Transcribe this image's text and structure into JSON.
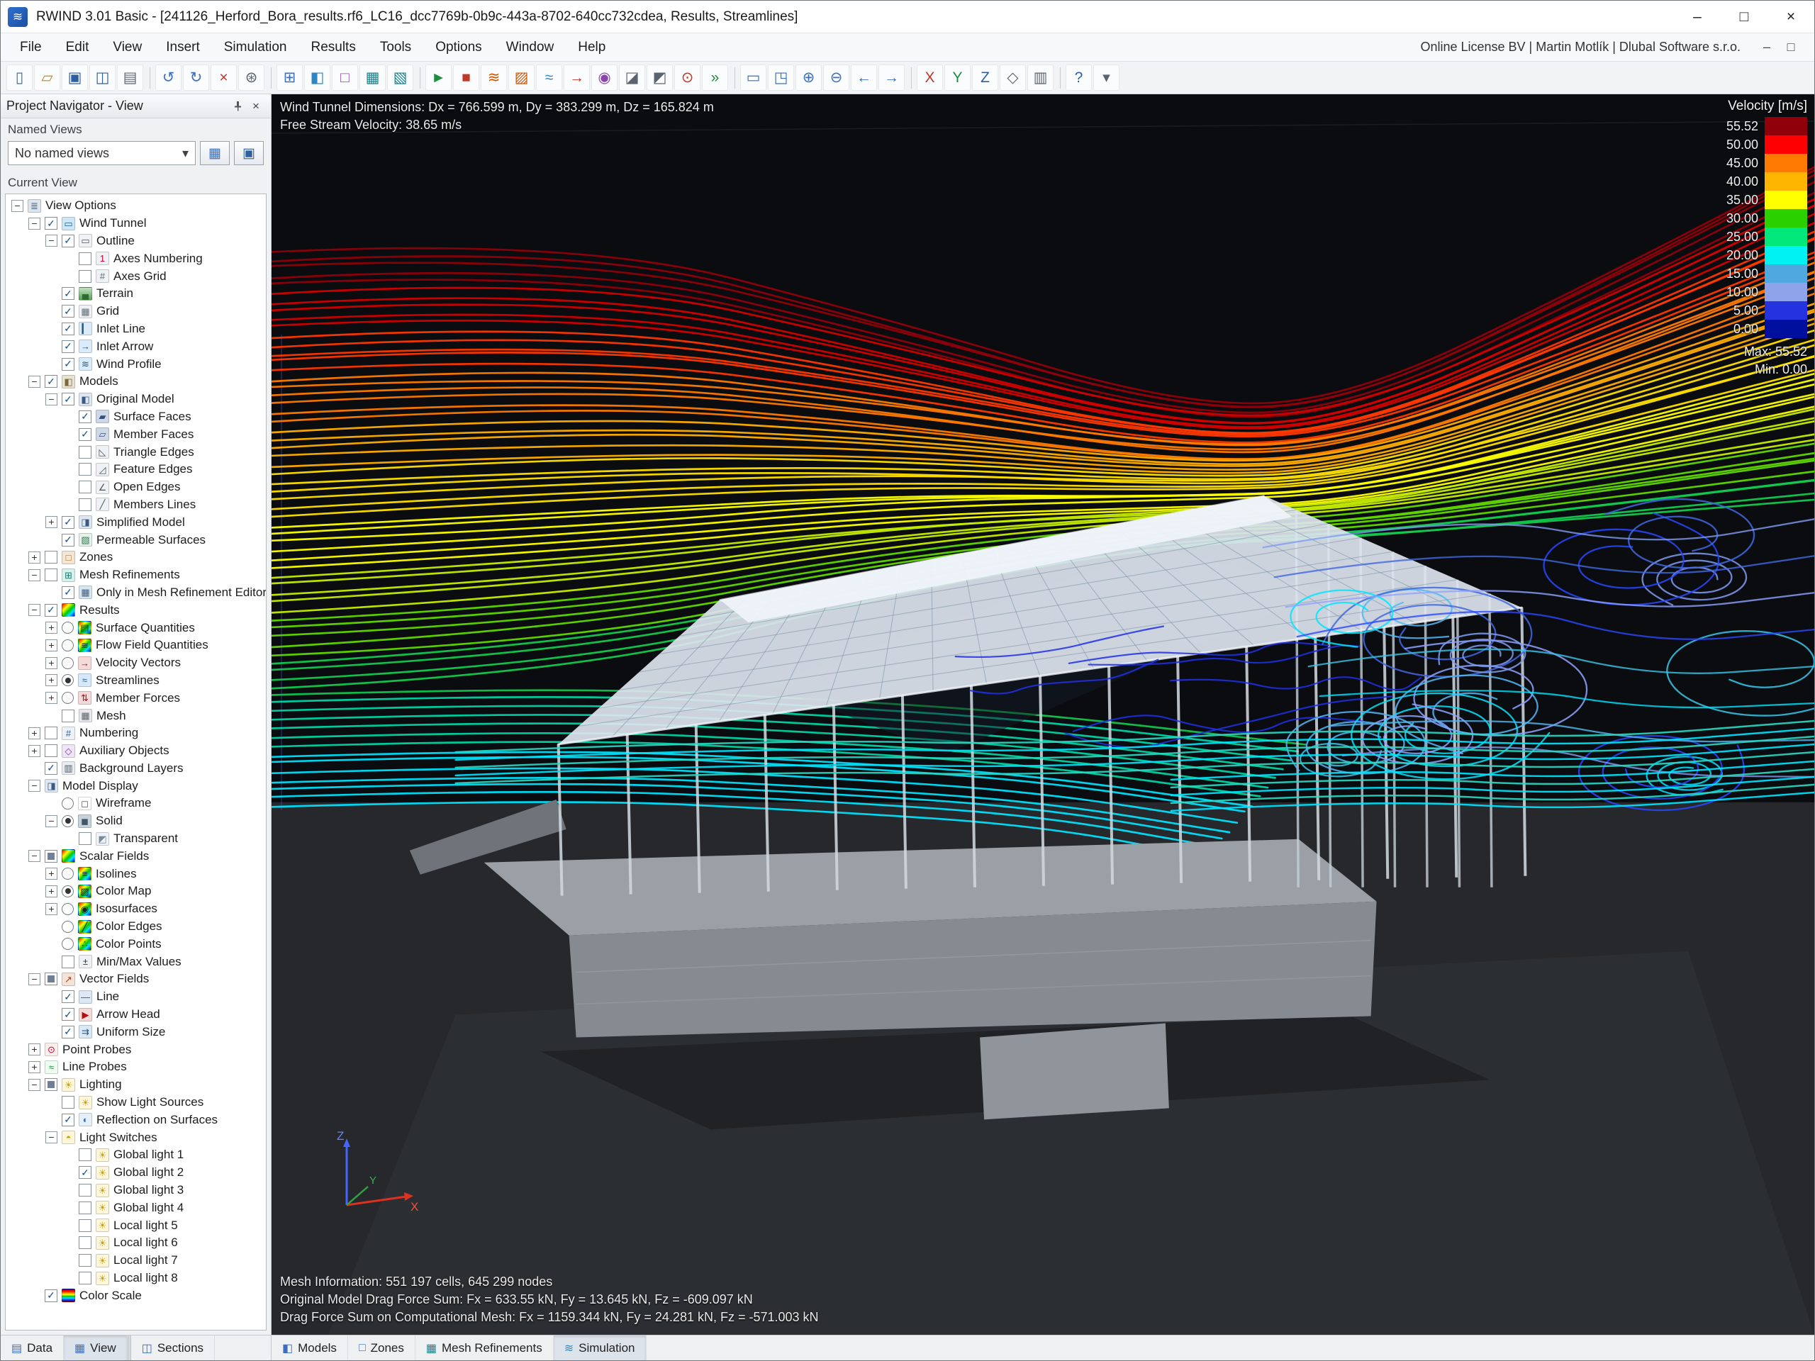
{
  "window": {
    "title": "RWIND 3.01 Basic - [241126_Herford_Bora_results.rf6_LC16_dcc7769b-0b9c-443a-8702-640cc732cdea, Results, Streamlines]",
    "buttons": [
      {
        "name": "minimize-button",
        "glyph": "–"
      },
      {
        "name": "maximize-button",
        "glyph": "□"
      },
      {
        "name": "close-button",
        "glyph": "×"
      }
    ]
  },
  "menu": {
    "items": [
      "File",
      "Edit",
      "View",
      "Insert",
      "Simulation",
      "Results",
      "Tools",
      "Options",
      "Window",
      "Help"
    ],
    "right_text": "Online License BV | Martin Motlík | Dlubal Software s.r.o.",
    "mdi_buttons": [
      {
        "name": "mdi-minimize-button",
        "glyph": "–"
      },
      {
        "name": "mdi-restore-button",
        "glyph": "□"
      }
    ]
  },
  "toolbar": {
    "items": [
      {
        "name": "new",
        "glyph": "▯",
        "color": "#4f6b8f"
      },
      {
        "name": "open",
        "glyph": "▱",
        "color": "#c08a1a"
      },
      {
        "name": "save",
        "glyph": "▣",
        "color": "#2f5fa3"
      },
      {
        "name": "save-all",
        "glyph": "◫",
        "color": "#2f5fa3"
      },
      {
        "name": "print",
        "glyph": "▤",
        "color": "#5a6470"
      },
      {
        "sep": true
      },
      {
        "name": "undo",
        "glyph": "↺",
        "color": "#3a6fbf"
      },
      {
        "name": "redo",
        "glyph": "↻",
        "color": "#3a6fbf"
      },
      {
        "name": "delete",
        "glyph": "×",
        "color": "#c0392b"
      },
      {
        "name": "settings",
        "glyph": "⊛",
        "color": "#5a6470"
      },
      {
        "sep": true
      },
      {
        "name": "tables",
        "glyph": "⊞",
        "color": "#3a6fbf"
      },
      {
        "name": "wind-tunnel",
        "glyph": "◧",
        "color": "#2e86c1"
      },
      {
        "name": "zones",
        "glyph": "□",
        "color": "#8e44ad"
      },
      {
        "name": "mesh",
        "glyph": "▦",
        "color": "#16808c"
      },
      {
        "name": "mesh-settings",
        "glyph": "▧",
        "color": "#16808c"
      },
      {
        "sep": true
      },
      {
        "name": "start-simulation",
        "glyph": "►",
        "color": "#1e8e3e"
      },
      {
        "name": "stop-simulation",
        "glyph": "■",
        "color": "#c0392b"
      },
      {
        "name": "results",
        "glyph": "≋",
        "color": "#d35400"
      },
      {
        "name": "surface-results",
        "glyph": "▨",
        "color": "#d35400"
      },
      {
        "name": "streamlines",
        "glyph": "≈",
        "color": "#2e86c1"
      },
      {
        "name": "velocity-vectors",
        "glyph": "→",
        "color": "#c0392b"
      },
      {
        "name": "isosurfaces",
        "glyph": "◉",
        "color": "#8e44ad"
      },
      {
        "name": "clipping-plane",
        "glyph": "◪",
        "color": "#5a6470"
      },
      {
        "name": "section-plane",
        "glyph": "◩",
        "color": "#5a6470"
      },
      {
        "name": "probe",
        "glyph": "⊙",
        "color": "#c0392b"
      },
      {
        "name": "animation",
        "glyph": "»",
        "color": "#1e8e3e"
      },
      {
        "sep": true
      },
      {
        "name": "zoom-all",
        "glyph": "▭",
        "color": "#3a6fbf"
      },
      {
        "name": "zoom-window",
        "glyph": "◳",
        "color": "#3a6fbf"
      },
      {
        "name": "zoom-in",
        "glyph": "⊕",
        "color": "#3a6fbf"
      },
      {
        "name": "zoom-out",
        "glyph": "⊖",
        "color": "#3a6fbf"
      },
      {
        "name": "previous-view",
        "glyph": "←",
        "color": "#3a6fbf"
      },
      {
        "name": "next-view",
        "glyph": "→",
        "color": "#3a6fbf"
      },
      {
        "sep": true
      },
      {
        "name": "view-x",
        "glyph": "X",
        "color": "#c0392b"
      },
      {
        "name": "view-y",
        "glyph": "Y",
        "color": "#1e8e3e"
      },
      {
        "name": "view-z",
        "glyph": "Z",
        "color": "#2f5fa3"
      },
      {
        "name": "isometric-view",
        "glyph": "◇",
        "color": "#5a6470"
      },
      {
        "name": "fullscreen",
        "glyph": "▥",
        "color": "#5a6470"
      },
      {
        "sep": true
      },
      {
        "name": "help",
        "glyph": "?",
        "color": "#2f5fa3"
      },
      {
        "name": "toolbar-overflow",
        "glyph": "▾",
        "color": "#5a6470"
      }
    ]
  },
  "navigator": {
    "title": "Project Navigator - View",
    "named_views_label": "Named Views",
    "named_views_value": "No named views",
    "current_view_label": "Current View",
    "tree": [
      {
        "label": "View Options",
        "depth": 0,
        "expand": "-",
        "icon": "view-options-icon"
      },
      {
        "label": "Wind Tunnel",
        "depth": 1,
        "expand": "-",
        "ctrl": "check",
        "state": true,
        "icon": "wind-tunnel-icon"
      },
      {
        "label": "Outline",
        "depth": 2,
        "expand": "-",
        "ctrl": "check",
        "state": true,
        "icon": "outline-icon"
      },
      {
        "label": "Axes Numbering",
        "depth": 3,
        "ctrl": "check",
        "state": false,
        "icon": "axes-numbering-icon"
      },
      {
        "label": "Axes Grid",
        "depth": 3,
        "ctrl": "check",
        "state": false,
        "icon": "axes-grid-icon"
      },
      {
        "label": "Terrain",
        "depth": 2,
        "ctrl": "check",
        "state": true,
        "icon": "terrain-icon"
      },
      {
        "label": "Grid",
        "depth": 2,
        "ctrl": "check",
        "state": true,
        "icon": "grid-icon"
      },
      {
        "label": "Inlet Line",
        "depth": 2,
        "ctrl": "check",
        "state": true,
        "icon": "inlet-line-icon"
      },
      {
        "label": "Inlet Arrow",
        "depth": 2,
        "ctrl": "check",
        "state": true,
        "icon": "inlet-arrow-icon"
      },
      {
        "label": "Wind Profile",
        "depth": 2,
        "ctrl": "check",
        "state": true,
        "icon": "wind-profile-icon"
      },
      {
        "label": "Models",
        "depth": 1,
        "expand": "-",
        "ctrl": "check",
        "state": true,
        "icon": "models-icon"
      },
      {
        "label": "Original Model",
        "depth": 2,
        "expand": "-",
        "ctrl": "check",
        "state": true,
        "icon": "original-model-icon"
      },
      {
        "label": "Surface Faces",
        "depth": 3,
        "ctrl": "check",
        "state": true,
        "icon": "surface-faces-icon"
      },
      {
        "label": "Member Faces",
        "depth": 3,
        "ctrl": "check",
        "state": true,
        "icon": "member-faces-icon"
      },
      {
        "label": "Triangle Edges",
        "depth": 3,
        "ctrl": "check",
        "state": false,
        "icon": "triangle-edges-icon"
      },
      {
        "label": "Feature Edges",
        "depth": 3,
        "ctrl": "check",
        "state": false,
        "icon": "feature-edges-icon"
      },
      {
        "label": "Open Edges",
        "depth": 3,
        "ctrl": "check",
        "state": false,
        "icon": "open-edges-icon"
      },
      {
        "label": "Members Lines",
        "depth": 3,
        "ctrl": "check",
        "state": false,
        "icon": "members-lines-icon"
      },
      {
        "label": "Simplified Model",
        "depth": 2,
        "expand": "+",
        "ctrl": "check",
        "state": true,
        "icon": "simplified-model-icon"
      },
      {
        "label": "Permeable Surfaces",
        "depth": 2,
        "ctrl": "check",
        "state": true,
        "icon": "permeable-surfaces-icon"
      },
      {
        "label": "Zones",
        "depth": 1,
        "expand": "+",
        "ctrl": "check",
        "state": false,
        "icon": "zones-icon"
      },
      {
        "label": "Mesh Refinements",
        "depth": 1,
        "expand": "-",
        "ctrl": "check",
        "state": false,
        "icon": "mesh-refinements-icon"
      },
      {
        "label": "Only in Mesh Refinement Editor",
        "depth": 2,
        "ctrl": "check",
        "state": true,
        "icon": "mesh-editor-icon"
      },
      {
        "label": "Results",
        "depth": 1,
        "expand": "-",
        "ctrl": "check",
        "state": true,
        "icon": "results-icon"
      },
      {
        "label": "Surface Quantities",
        "depth": 2,
        "expand": "+",
        "ctrl": "radio",
        "state": false,
        "icon": "surface-quantities-icon"
      },
      {
        "label": "Flow Field Quantities",
        "depth": 2,
        "expand": "+",
        "ctrl": "radio",
        "state": false,
        "icon": "flow-field-icon"
      },
      {
        "label": "Velocity Vectors",
        "depth": 2,
        "expand": "+",
        "ctrl": "radio",
        "state": false,
        "icon": "velocity-vectors-icon"
      },
      {
        "label": "Streamlines",
        "depth": 2,
        "expand": "+",
        "ctrl": "radio",
        "state": true,
        "icon": "streamlines-icon"
      },
      {
        "label": "Member Forces",
        "depth": 2,
        "expand": "+",
        "ctrl": "radio",
        "state": false,
        "icon": "member-forces-icon"
      },
      {
        "label": "Mesh",
        "depth": 2,
        "ctrl": "check",
        "state": false,
        "icon": "mesh-icon"
      },
      {
        "label": "Numbering",
        "depth": 1,
        "expand": "+",
        "ctrl": "check",
        "state": false,
        "icon": "numbering-icon"
      },
      {
        "label": "Auxiliary Objects",
        "depth": 1,
        "expand": "+",
        "ctrl": "check",
        "state": false,
        "icon": "auxiliary-objects-icon"
      },
      {
        "label": "Background Layers",
        "depth": 1,
        "ctrl": "check",
        "state": true,
        "icon": "background-layers-icon"
      },
      {
        "label": "Model Display",
        "depth": 1,
        "expand": "-",
        "icon": "model-display-icon"
      },
      {
        "label": "Wireframe",
        "depth": 2,
        "ctrl": "radio",
        "state": false,
        "icon": "wireframe-icon"
      },
      {
        "label": "Solid",
        "depth": 2,
        "expand": "-",
        "ctrl": "radio",
        "state": true,
        "icon": "solid-icon"
      },
      {
        "label": "Transparent",
        "depth": 3,
        "ctrl": "check",
        "state": false,
        "icon": "transparent-icon"
      },
      {
        "label": "Scalar Fields",
        "depth": 1,
        "expand": "-",
        "ctrl": "check",
        "state": "partial",
        "icon": "scalar-fields-icon"
      },
      {
        "label": "Isolines",
        "depth": 2,
        "expand": "+",
        "ctrl": "radio",
        "state": false,
        "icon": "isolines-icon"
      },
      {
        "label": "Color Map",
        "depth": 2,
        "expand": "+",
        "ctrl": "radio",
        "state": true,
        "icon": "color-map-icon"
      },
      {
        "label": "Isosurfaces",
        "depth": 2,
        "expand": "+",
        "ctrl": "radio",
        "state": false,
        "icon": "isosurfaces-icon"
      },
      {
        "label": "Color Edges",
        "depth": 2,
        "ctrl": "radio",
        "state": false,
        "icon": "color-edges-icon"
      },
      {
        "label": "Color Points",
        "depth": 2,
        "ctrl": "radio",
        "state": false,
        "icon": "color-points-icon"
      },
      {
        "label": "Min/Max Values",
        "depth": 2,
        "ctrl": "check",
        "state": false,
        "icon": "minmax-values-icon"
      },
      {
        "label": "Vector Fields",
        "depth": 1,
        "expand": "-",
        "ctrl": "check",
        "state": "partial",
        "icon": "vector-fields-icon"
      },
      {
        "label": "Line",
        "depth": 2,
        "ctrl": "check",
        "state": true,
        "icon": "line-icon"
      },
      {
        "label": "Arrow Head",
        "depth": 2,
        "ctrl": "check",
        "state": true,
        "icon": "arrow-head-icon"
      },
      {
        "label": "Uniform Size",
        "depth": 2,
        "ctrl": "check",
        "state": true,
        "icon": "uniform-size-icon"
      },
      {
        "label": "Point Probes",
        "depth": 1,
        "expand": "+",
        "icon": "point-probes-icon"
      },
      {
        "label": "Line Probes",
        "depth": 1,
        "expand": "+",
        "icon": "line-probes-icon"
      },
      {
        "label": "Lighting",
        "depth": 1,
        "expand": "-",
        "ctrl": "check",
        "state": "partial",
        "icon": "lighting-icon"
      },
      {
        "label": "Show Light Sources",
        "depth": 2,
        "ctrl": "check",
        "state": false,
        "icon": "show-light-sources-icon"
      },
      {
        "label": "Reflection on Surfaces",
        "depth": 2,
        "ctrl": "check",
        "state": true,
        "icon": "reflection-icon"
      },
      {
        "label": "Light Switches",
        "depth": 2,
        "expand": "-",
        "icon": "light-switches-icon"
      },
      {
        "label": "Global light 1",
        "depth": 3,
        "ctrl": "check",
        "state": false,
        "icon": "light-icon"
      },
      {
        "label": "Global light 2",
        "depth": 3,
        "ctrl": "check",
        "state": true,
        "icon": "light-icon"
      },
      {
        "label": "Global light 3",
        "depth": 3,
        "ctrl": "check",
        "state": false,
        "icon": "light-icon"
      },
      {
        "label": "Global light 4",
        "depth": 3,
        "ctrl": "check",
        "state": false,
        "icon": "light-icon"
      },
      {
        "label": "Local light 5",
        "depth": 3,
        "ctrl": "check",
        "state": false,
        "icon": "light-icon"
      },
      {
        "label": "Local light 6",
        "depth": 3,
        "ctrl": "check",
        "state": false,
        "icon": "light-icon"
      },
      {
        "label": "Local light 7",
        "depth": 3,
        "ctrl": "check",
        "state": false,
        "icon": "light-icon"
      },
      {
        "label": "Local light 8",
        "depth": 3,
        "ctrl": "check",
        "state": false,
        "icon": "light-icon"
      },
      {
        "label": "Color Scale",
        "depth": 1,
        "ctrl": "check",
        "state": true,
        "icon": "color-scale-icon"
      }
    ]
  },
  "viewport": {
    "top_lines": [
      "Wind Tunnel Dimensions: Dx = 766.599 m, Dy = 383.299 m, Dz = 165.824 m",
      "Free Stream Velocity: 38.65 m/s"
    ],
    "bottom_lines": [
      "Mesh Information: 551 197 cells, 645 299 nodes",
      "Original Model Drag Force Sum: Fx = 633.55 kN, Fy = 13.645 kN, Fz = -609.097 kN",
      "Drag Force Sum on Computational Mesh: Fx = 1159.344 kN, Fy = 24.281 kN, Fz = -571.003 kN"
    ],
    "axes": {
      "x": "X",
      "y": "Y",
      "z": "Z"
    }
  },
  "legend": {
    "title": "Velocity [m/s]",
    "entries": [
      {
        "value": "55.52",
        "color": "#8f000a"
      },
      {
        "value": "50.00",
        "color": "#fe0002"
      },
      {
        "value": "45.00",
        "color": "#ff7a00"
      },
      {
        "value": "40.00",
        "color": "#ffb400"
      },
      {
        "value": "35.00",
        "color": "#ffff00"
      },
      {
        "value": "30.00",
        "color": "#2bd000"
      },
      {
        "value": "25.00",
        "color": "#00e87a"
      },
      {
        "value": "20.00",
        "color": "#00f2f2"
      },
      {
        "value": "15.00",
        "color": "#4fa8e0"
      },
      {
        "value": "10.00",
        "color": "#8fa3ea"
      },
      {
        "value": "5.00",
        "color": "#2433dd"
      },
      {
        "value": "0.00",
        "color": "#000f9e"
      }
    ],
    "max_label": "Max: 55.52",
    "min_label": "Min: 0.00"
  },
  "statusbar": {
    "left_tabs": [
      {
        "name": "tab-data",
        "label": "Data",
        "icon_glyph": "▤",
        "icon_color": "#3a6fbf"
      },
      {
        "name": "tab-view",
        "label": "View",
        "active": true,
        "icon_glyph": "▦",
        "icon_color": "#3a6fbf"
      },
      {
        "divider": true
      },
      {
        "name": "tab-sections",
        "label": "Sections",
        "icon_glyph": "◫",
        "icon_color": "#3a6fbf"
      }
    ],
    "main_tabs": [
      {
        "name": "tab-models",
        "label": "Models",
        "icon_glyph": "◧",
        "icon_color": "#3a6fbf"
      },
      {
        "name": "tab-zones",
        "label": "Zones",
        "icon_glyph": "□",
        "icon_color": "#3a6fbf"
      },
      {
        "name": "tab-mesh-refinements",
        "label": "Mesh Refinements",
        "icon_glyph": "▦",
        "icon_color": "#16808c"
      },
      {
        "name": "tab-simulation",
        "label": "Simulation",
        "active": true,
        "icon_glyph": "≋",
        "icon_color": "#2e86c1"
      }
    ]
  }
}
